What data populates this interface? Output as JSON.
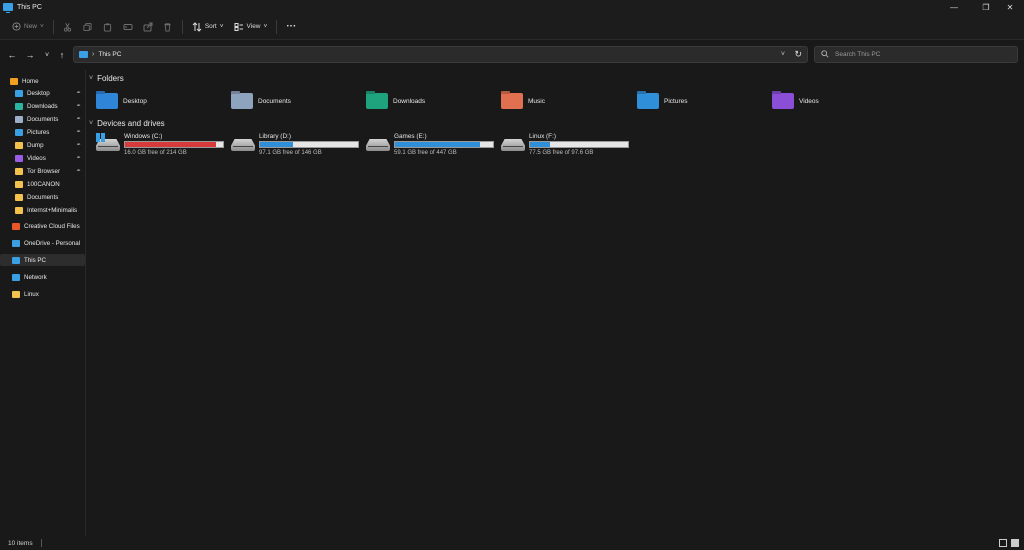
{
  "window": {
    "title": "This PC"
  },
  "toolbar": {
    "new_label": "New",
    "sort_label": "Sort",
    "view_label": "View",
    "more_label": "···"
  },
  "navigation": {
    "address": "This PC",
    "search_placeholder": "Search This PC"
  },
  "sidebar": {
    "items": [
      {
        "label": "Home",
        "icon": "home-icon",
        "color": "#f0a020"
      },
      {
        "label": "Desktop",
        "icon": "desktop-icon",
        "color": "#3aa0e6",
        "pinned": true
      },
      {
        "label": "Downloads",
        "icon": "downloads-icon",
        "color": "#2bb5a0",
        "pinned": true
      },
      {
        "label": "Documents",
        "icon": "documents-icon",
        "color": "#9bb0c8",
        "pinned": true
      },
      {
        "label": "Pictures",
        "icon": "pictures-icon",
        "color": "#3a9ee0",
        "pinned": true
      },
      {
        "label": "Dump",
        "icon": "folder-icon",
        "color": "#f2c14e",
        "pinned": true
      },
      {
        "label": "Videos",
        "icon": "videos-icon",
        "color": "#9b5de5",
        "pinned": true
      },
      {
        "label": "Tor Browser",
        "icon": "folder-icon",
        "color": "#f2c14e",
        "pinned": true
      },
      {
        "label": "100CANON",
        "icon": "folder-icon",
        "color": "#f2c14e"
      },
      {
        "label": "Documents",
        "icon": "folder-icon",
        "color": "#f2c14e"
      },
      {
        "label": "Internst+Minimalis",
        "icon": "folder-icon",
        "color": "#f2c14e"
      },
      {
        "label": "Creative Cloud Files",
        "icon": "creative-cloud-icon",
        "color": "#e8562a"
      },
      {
        "label": "OneDrive - Personal",
        "icon": "onedrive-icon",
        "color": "#3a9ee0"
      },
      {
        "label": "This PC",
        "icon": "this-pc-icon",
        "color": "#3aa0e6",
        "selected": true
      },
      {
        "label": "Network",
        "icon": "network-icon",
        "color": "#3aa0e6"
      },
      {
        "label": "Linux",
        "icon": "linux-icon",
        "color": "#f2c14e"
      }
    ]
  },
  "folders_section": {
    "title": "Folders"
  },
  "folders": [
    {
      "label": "Desktop",
      "icon": "desktop-folder-icon",
      "color": "#2f86d8"
    },
    {
      "label": "Documents",
      "icon": "documents-folder-icon",
      "color": "#8ea3bd"
    },
    {
      "label": "Downloads",
      "icon": "downloads-folder-icon",
      "color": "#1fa37f"
    },
    {
      "label": "Music",
      "icon": "music-folder-icon",
      "color": "#e07050"
    },
    {
      "label": "Pictures",
      "icon": "pictures-folder-icon",
      "color": "#2f8fd8"
    },
    {
      "label": "Videos",
      "icon": "videos-folder-icon",
      "color": "#8a4fd6"
    }
  ],
  "drives_section": {
    "title": "Devices and drives"
  },
  "drives": [
    {
      "name": "Windows (C:)",
      "free": "16.0 GB free of 214 GB",
      "used_fraction": 0.925,
      "bar_color": "#d63a3a",
      "icon": "windows-drive-icon"
    },
    {
      "name": "Library (D:)",
      "free": "97.1 GB free of 146 GB",
      "used_fraction": 0.335,
      "bar_color": "#2f8fd8",
      "icon": "hard-drive-icon"
    },
    {
      "name": "Games (E:)",
      "free": "59.1 GB free of 447 GB",
      "used_fraction": 0.868,
      "bar_color": "#2f8fd8",
      "icon": "hard-drive-icon"
    },
    {
      "name": "Linux (F:)",
      "free": "77.5 GB free of 97.6 GB",
      "used_fraction": 0.206,
      "bar_color": "#2f8fd8",
      "icon": "hard-drive-icon"
    }
  ],
  "statusbar": {
    "item_count": "10 items"
  }
}
